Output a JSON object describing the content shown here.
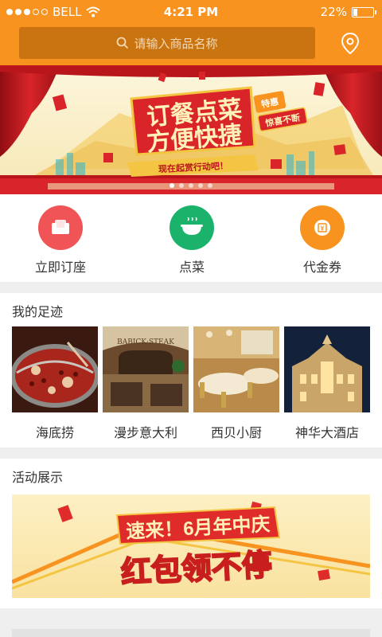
{
  "status_bar": {
    "carrier": "BELL",
    "time": "4:21 PM",
    "battery_text": "22%",
    "battery_level": 0.22,
    "signal_bars_filled": 3,
    "signal_bars_total": 5
  },
  "search": {
    "placeholder": "请输入商品名称",
    "icon": "search-icon"
  },
  "location_icon": "location-pin-icon",
  "banner": {
    "headline_1": "订餐点菜",
    "headline_2": "方便快捷",
    "tag_1": "特惠",
    "tag_2": "惊喜不断",
    "ribbon": "现在起赏行动吧！",
    "slide_count": 5,
    "active_slide": 1
  },
  "quick_actions": [
    {
      "label": "立即订座",
      "icon": "armchair-icon",
      "color": "#f05456"
    },
    {
      "label": "点菜",
      "icon": "dish-icon",
      "color": "#1bb36b"
    },
    {
      "label": "代金券",
      "icon": "voucher-icon",
      "color": "#f7931e"
    }
  ],
  "footprints": {
    "title": "我的足迹",
    "items": [
      {
        "name": "海底捞"
      },
      {
        "name": "漫步意大利"
      },
      {
        "name": "西贝小厨"
      },
      {
        "name": "神华大酒店"
      }
    ],
    "sign_text": "BABICK·STEAK"
  },
  "activities": {
    "title": "活动展示",
    "promo_line_1": "速来！6月年中庆",
    "promo_line_2": "红包领不停"
  },
  "colors": {
    "brand": "#f7931e",
    "search_bg": "#c97410",
    "banner_red": "#d9252a"
  }
}
